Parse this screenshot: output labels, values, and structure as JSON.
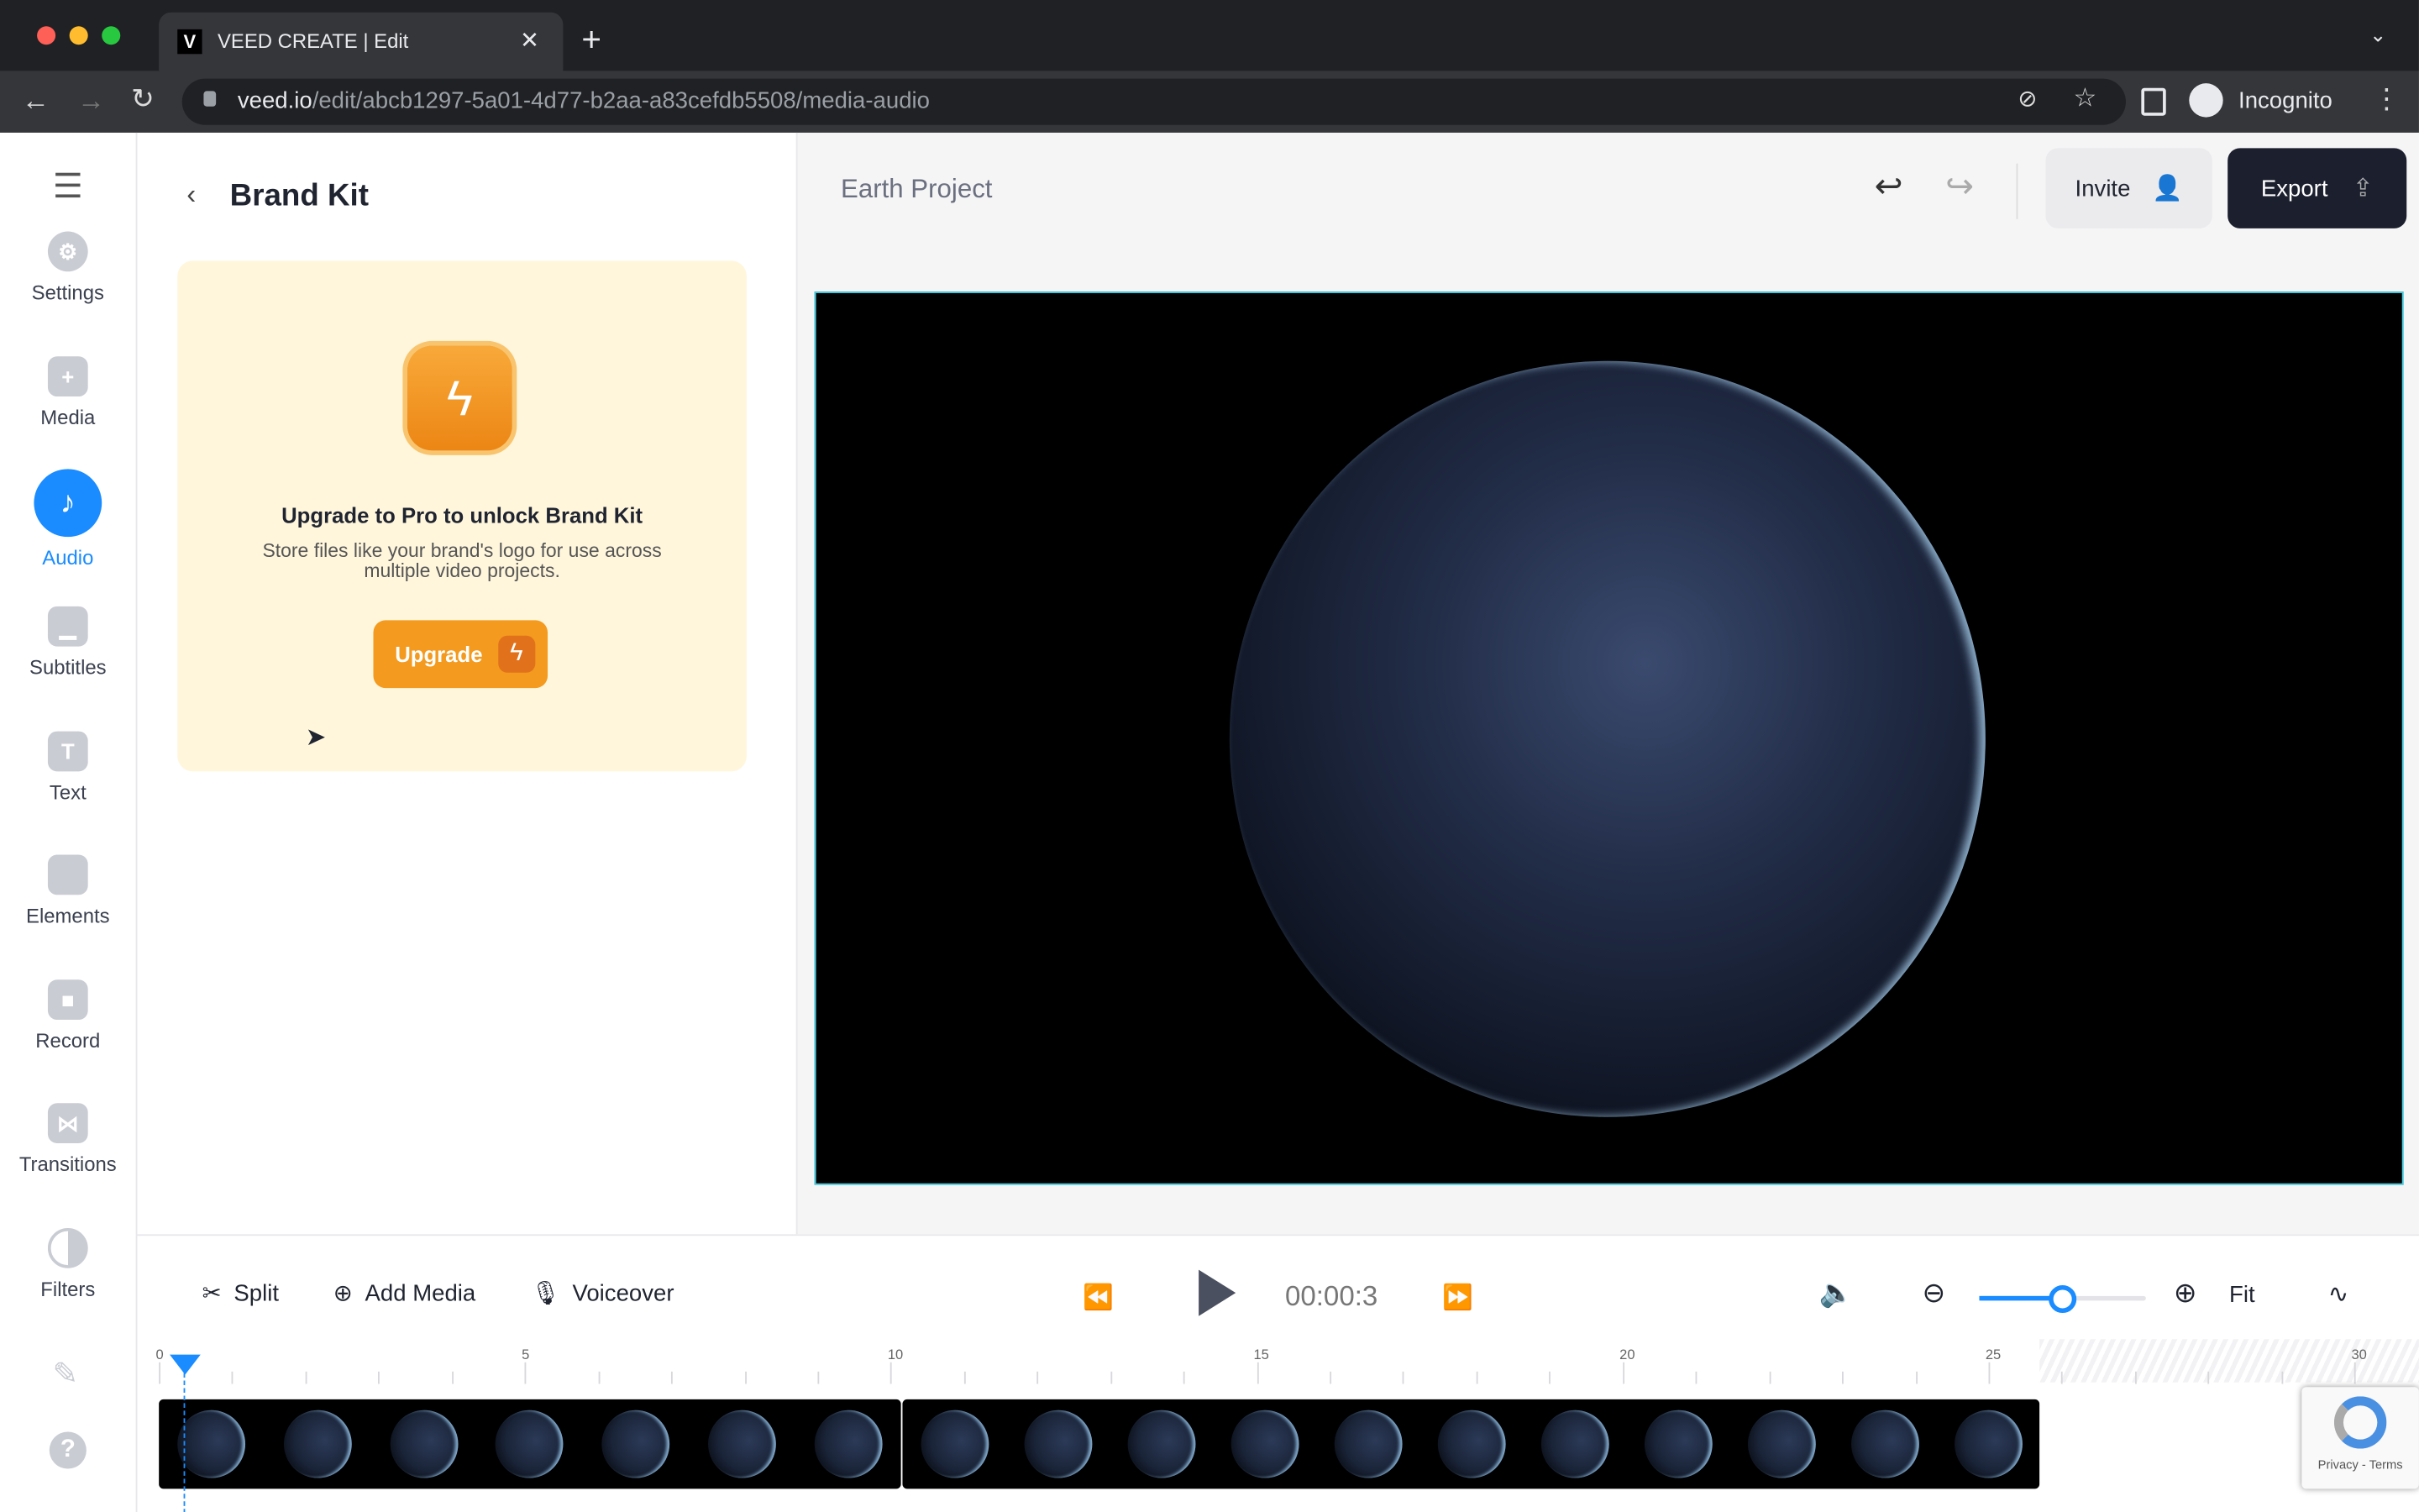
{
  "browser": {
    "tab_title": "VEED CREATE | Edit",
    "url_domain": "veed.io",
    "url_path": "/edit/abcb1297-5a01-4d77-b2aa-a83cefdb5508/media-audio",
    "profile": "Incognito"
  },
  "sidebar": {
    "items": [
      {
        "label": "Settings",
        "icon": "gear-icon"
      },
      {
        "label": "Media",
        "icon": "plus-icon"
      },
      {
        "label": "Audio",
        "icon": "music-note-icon",
        "active": true
      },
      {
        "label": "Subtitles",
        "icon": "subtitles-icon"
      },
      {
        "label": "Text",
        "icon": "text-icon"
      },
      {
        "label": "Elements",
        "icon": "elements-icon"
      },
      {
        "label": "Record",
        "icon": "camera-icon"
      },
      {
        "label": "Transitions",
        "icon": "transitions-icon"
      },
      {
        "label": "Filters",
        "icon": "filters-icon"
      }
    ]
  },
  "panel": {
    "title": "Brand Kit",
    "card_heading": "Upgrade to Pro to unlock Brand Kit",
    "card_text": "Store files like your brand's logo for use across multiple video projects.",
    "upgrade_label": "Upgrade"
  },
  "header": {
    "project_name": "Earth Project",
    "invite_label": "Invite",
    "export_label": "Export"
  },
  "toolbar": {
    "split": "Split",
    "add_media": "Add Media",
    "voiceover": "Voiceover",
    "time": "00:00:3",
    "fit": "Fit",
    "zoom_level": 0.5
  },
  "timeline": {
    "ticks": [
      "0",
      "5",
      "10",
      "15",
      "20",
      "25",
      "30"
    ]
  },
  "recaptcha": {
    "text": "Privacy - Terms"
  },
  "colors": {
    "accent": "#1a8cff",
    "export_bg": "#1b1f2e",
    "upgrade": "#f39a1f",
    "card_bg": "#fff6dc"
  }
}
